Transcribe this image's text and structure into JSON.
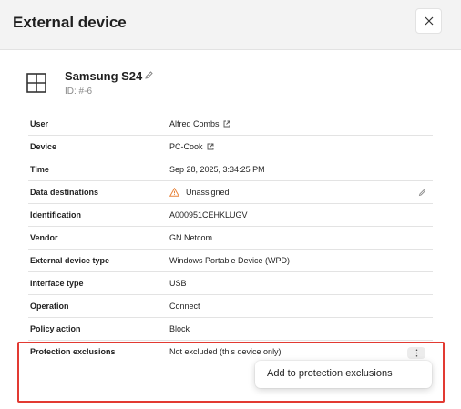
{
  "dialog": {
    "title": "External device"
  },
  "device": {
    "name": "Samsung S24",
    "id": "ID: #-6"
  },
  "details": {
    "user": {
      "label": "User",
      "value": "Alfred Combs"
    },
    "device": {
      "label": "Device",
      "value": "PC-Cook"
    },
    "time": {
      "label": "Time",
      "value": "Sep 28, 2025, 3:34:25 PM"
    },
    "data_destinations": {
      "label": "Data destinations",
      "value": "Unassigned"
    },
    "identification": {
      "label": "Identification",
      "value": "A000951CEHKLUGV"
    },
    "vendor": {
      "label": "Vendor",
      "value": "GN Netcom"
    },
    "external_device_type": {
      "label": "External device type",
      "value": "Windows Portable Device (WPD)"
    },
    "interface_type": {
      "label": "Interface type",
      "value": "USB"
    },
    "operation": {
      "label": "Operation",
      "value": "Connect"
    },
    "policy_action": {
      "label": "Policy action",
      "value": "Block"
    },
    "protection_exclusions": {
      "label": "Protection exclusions",
      "value": "Not excluded (this device only)"
    }
  },
  "menu": {
    "add_exclusion": "Add to protection exclusions"
  },
  "colors": {
    "highlight": "#e23a32",
    "warning": "#e8833a",
    "header_bg": "#f3f3f3"
  }
}
